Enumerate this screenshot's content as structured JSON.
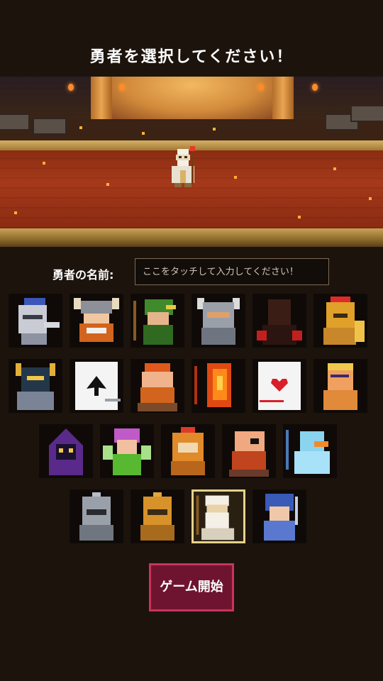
{
  "title": "勇者を選択してください！",
  "name_row": {
    "label": "勇者の名前:",
    "placeholder": "ここをタッチして入力してください！",
    "value": ""
  },
  "heroes": [
    {
      "icon": "blue-knight-icon",
      "selected": false
    },
    {
      "icon": "viking-icon",
      "selected": false
    },
    {
      "icon": "green-archer-icon",
      "selected": false
    },
    {
      "icon": "horned-knight-icon",
      "selected": false
    },
    {
      "icon": "shadow-brawler-icon",
      "selected": false
    },
    {
      "icon": "spartan-icon",
      "selected": false
    },
    {
      "icon": "gold-armor-icon",
      "selected": false
    },
    {
      "icon": "spade-card-icon",
      "selected": false
    },
    {
      "icon": "red-beard-icon",
      "selected": false
    },
    {
      "icon": "fire-elemental-icon",
      "selected": false
    },
    {
      "icon": "heart-card-icon",
      "selected": false
    },
    {
      "icon": "barbarian-icon",
      "selected": false
    },
    {
      "icon": "purple-mage-icon",
      "selected": false
    },
    {
      "icon": "fairy-icon",
      "selected": false
    },
    {
      "icon": "orange-helm-icon",
      "selected": false
    },
    {
      "icon": "eyepatch-dwarf-icon",
      "selected": false
    },
    {
      "icon": "ice-duck-icon",
      "selected": false
    },
    {
      "icon": "iron-knight-icon",
      "selected": false
    },
    {
      "icon": "gold-knight-icon",
      "selected": false
    },
    {
      "icon": "white-wizard-icon",
      "selected": true
    },
    {
      "icon": "blue-swordsman-icon",
      "selected": false
    }
  ],
  "start_label": "ゲーム開始",
  "colors": {
    "background": "#1c130d",
    "button": "#6e1430",
    "button_border": "#c9335a",
    "selected_border": "#e6d28a"
  }
}
